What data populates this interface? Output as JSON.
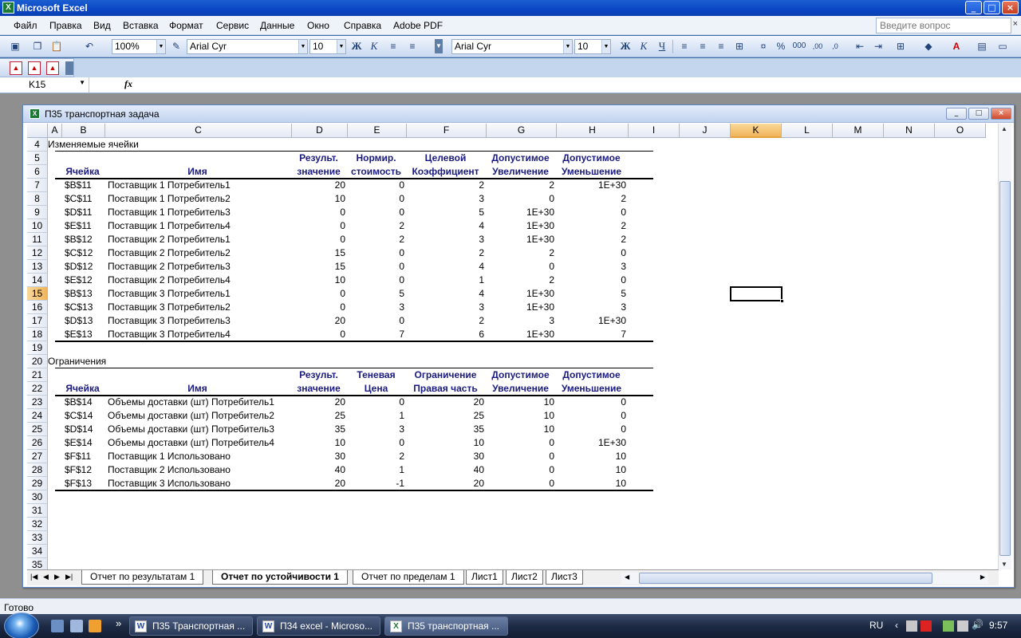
{
  "app_title": "Microsoft Excel",
  "window_buttons": {
    "minimize": "_",
    "restore": "□",
    "close": "×"
  },
  "menu": [
    "Файл",
    "Правка",
    "Вид",
    "Вставка",
    "Формат",
    "Сервис",
    "Данные",
    "Окно",
    "Справка",
    "Adobe PDF"
  ],
  "ask_placeholder": "Введите вопрос",
  "menu_close": "×",
  "toolbar": {
    "zoom": "100%",
    "font1": "Arial Cyr",
    "size1": "10",
    "font2": "Arial Cyr",
    "size2": "10",
    "bold": "Ж",
    "italic": "К",
    "underline": "Ч",
    "percent": "%",
    "thousands": "000",
    "dec_inc": ",00",
    "dec_dec": ",0"
  },
  "formula_bar": {
    "name_box": "K15",
    "fx": "fx",
    "formula": ""
  },
  "workbook": {
    "title": "П35 транспортная задача",
    "columns": [
      "A",
      "B",
      "C",
      "D",
      "E",
      "F",
      "G",
      "H",
      "I",
      "J",
      "K",
      "L",
      "M",
      "N",
      "O"
    ],
    "selected_column": "K",
    "selected_row": "15",
    "rows": [
      "4",
      "5",
      "6",
      "7",
      "8",
      "9",
      "10",
      "11",
      "12",
      "13",
      "14",
      "15",
      "16",
      "17",
      "18",
      "19",
      "20",
      "21",
      "22",
      "23",
      "24",
      "25",
      "26",
      "27",
      "28",
      "29",
      "30",
      "31",
      "32",
      "33",
      "34",
      "35"
    ],
    "section1_title": "Изменяемые ячейки",
    "section1_headers": {
      "row5": [
        "",
        "",
        "Результ.",
        "Нормир.",
        "Целевой",
        "Допустимое",
        "Допустимое"
      ],
      "row6": [
        "Ячейка",
        "Имя",
        "значение",
        "стоимость",
        "Коэффициент",
        "Увеличение",
        "Уменьшение"
      ]
    },
    "section1_rows": [
      [
        "$B$11",
        "Поставщик 1 Потребитель1",
        "20",
        "0",
        "2",
        "2",
        "1E+30"
      ],
      [
        "$C$11",
        "Поставщик 1 Потребитель2",
        "10",
        "0",
        "3",
        "0",
        "2"
      ],
      [
        "$D$11",
        "Поставщик 1 Потребитель3",
        "0",
        "0",
        "5",
        "1E+30",
        "0"
      ],
      [
        "$E$11",
        "Поставщик 1 Потребитель4",
        "0",
        "2",
        "4",
        "1E+30",
        "2"
      ],
      [
        "$B$12",
        "Поставщик 2 Потребитель1",
        "0",
        "2",
        "3",
        "1E+30",
        "2"
      ],
      [
        "$C$12",
        "Поставщик 2 Потребитель2",
        "15",
        "0",
        "2",
        "2",
        "0"
      ],
      [
        "$D$12",
        "Поставщик 2 Потребитель3",
        "15",
        "0",
        "4",
        "0",
        "3"
      ],
      [
        "$E$12",
        "Поставщик 2 Потребитель4",
        "10",
        "0",
        "1",
        "2",
        "0"
      ],
      [
        "$B$13",
        "Поставщик 3 Потребитель1",
        "0",
        "5",
        "4",
        "1E+30",
        "5"
      ],
      [
        "$C$13",
        "Поставщик 3 Потребитель2",
        "0",
        "3",
        "3",
        "1E+30",
        "3"
      ],
      [
        "$D$13",
        "Поставщик 3 Потребитель3",
        "20",
        "0",
        "2",
        "3",
        "1E+30"
      ],
      [
        "$E$13",
        "Поставщик 3 Потребитель4",
        "0",
        "7",
        "6",
        "1E+30",
        "7"
      ]
    ],
    "section2_title": "Ограничения",
    "section2_headers": {
      "row21": [
        "",
        "",
        "Результ.",
        "Теневая",
        "Ограничение",
        "Допустимое",
        "Допустимое"
      ],
      "row22": [
        "Ячейка",
        "Имя",
        "значение",
        "Цена",
        "Правая часть",
        "Увеличение",
        "Уменьшение"
      ]
    },
    "section2_rows": [
      [
        "$B$14",
        "Объемы доставки (шт) Потребитель1",
        "20",
        "0",
        "20",
        "10",
        "0"
      ],
      [
        "$C$14",
        "Объемы доставки (шт) Потребитель2",
        "25",
        "1",
        "25",
        "10",
        "0"
      ],
      [
        "$D$14",
        "Объемы доставки (шт) Потребитель3",
        "35",
        "3",
        "35",
        "10",
        "0"
      ],
      [
        "$E$14",
        "Объемы доставки (шт) Потребитель4",
        "10",
        "0",
        "10",
        "0",
        "1E+30"
      ],
      [
        "$F$11",
        "Поставщик 1 Использовано",
        "30",
        "2",
        "30",
        "0",
        "10"
      ],
      [
        "$F$12",
        "Поставщик 2 Использовано",
        "40",
        "1",
        "40",
        "0",
        "10"
      ],
      [
        "$F$13",
        "Поставщик 3 Использовано",
        "20",
        "-1",
        "20",
        "0",
        "10"
      ]
    ],
    "sheet_tabs": [
      "Отчет по результатам 1",
      "Отчет по устойчивости 1",
      "Отчет по пределам 1",
      "Лист1",
      "Лист2",
      "Лист3"
    ],
    "active_tab": "Отчет по устойчивости 1"
  },
  "status": "Готово",
  "taskbar": {
    "tasks": [
      "П35 Транспортная ...",
      "П34 excel - Microso...",
      "П35 транспортная ..."
    ],
    "more": "»",
    "lang": "RU",
    "time": "9:57"
  }
}
